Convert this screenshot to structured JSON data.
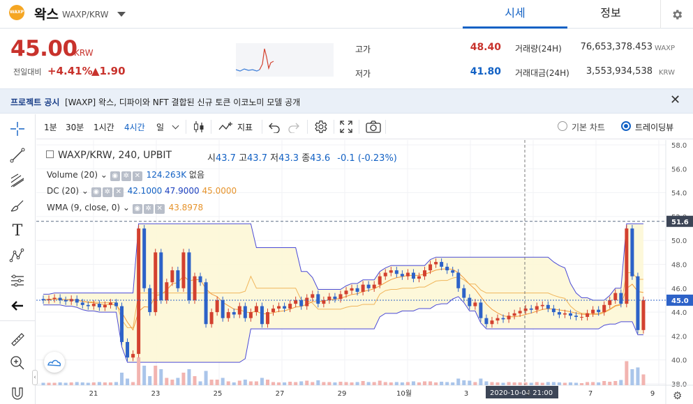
{
  "header": {
    "logo_text": "WAXP",
    "coin_name": "왁스",
    "pair": "WAXP/KRW",
    "tabs": [
      "시세",
      "정보"
    ]
  },
  "price": {
    "current": "45.00",
    "unit": "KRW",
    "change_label": "전일대비",
    "change_pct": "+4.41%",
    "change_abs": "▲1.90"
  },
  "stats": {
    "high_label": "고가",
    "high_value": "48.40",
    "low_label": "저가",
    "low_value": "41.80",
    "volume_label": "거래량(24H)",
    "volume_value": "76,653,378.453",
    "volume_unit": "WAXP",
    "amount_label": "거래대금(24H)",
    "amount_value": "3,553,934,538",
    "amount_unit": "KRW"
  },
  "notice": {
    "title": "프로젝트 공시",
    "text": "[WAXP] 왁스, 디파이와 NFT 결합된 신규 토큰 이코노미 모델 공개"
  },
  "toolbar": {
    "intervals": [
      "1분",
      "30분",
      "1시간",
      "4시간",
      "일"
    ],
    "active_interval": "4시간",
    "indicators_label": "지표",
    "basic_chart_label": "기본 차트",
    "tradingview_label": "트레이딩뷰"
  },
  "chart_legend": {
    "symbol": "WAXP/KRW, 240, UPBIT",
    "o_label": "시",
    "o": "43.7",
    "h_label": "고",
    "h": "43.7",
    "l_label": "저",
    "l": "43.3",
    "c_label": "종",
    "c": "43.6",
    "change": "-0.1 (-0.23%)",
    "volume_name": "Volume (20)",
    "volume_value": "124.263K",
    "volume_extra": "없음",
    "dc_name": "DC (20)",
    "dc_low": "42.1000",
    "dc_high": "47.9000",
    "dc_mid": "45.0000",
    "wma_name": "WMA (9, close, 0)",
    "wma_value": "43.8978"
  },
  "chart_data": {
    "type": "candlestick",
    "y_ticks": [
      "58.0",
      "56.0",
      "54.0",
      "52.0",
      "50.0",
      "48.0",
      "46.0",
      "44.0",
      "42.0",
      "40.0",
      "38.0"
    ],
    "ylim": [
      38,
      58
    ],
    "x_ticks": [
      "21",
      "23",
      "25",
      "27",
      "29",
      "10월",
      "3",
      "5",
      "7",
      "9"
    ],
    "crosshair_x_label": "2020-10-04  21:00",
    "price_label": "45.0",
    "high_line_label": "51.6",
    "closes": [
      45.0,
      45.1,
      45.2,
      45.0,
      44.9,
      45.1,
      44.8,
      44.6,
      44.5,
      44.7,
      44.4,
      44.6,
      44.8,
      44.5,
      41.5,
      40.2,
      40.5,
      51.0,
      46.0,
      44.0,
      49.0,
      45.0,
      46.5,
      47.5,
      46.0,
      49.0,
      45.0,
      47.0,
      46.5,
      43.0,
      44.0,
      45.0,
      43.5,
      44.0,
      43.8,
      44.5,
      43.5,
      44.0,
      44.5,
      43.0,
      44.0,
      44.3,
      44.5,
      44.3,
      44.7,
      45.0,
      44.5,
      45.2,
      45.5,
      44.7,
      45.0,
      45.3,
      45.1,
      45.5,
      45.8,
      46.0,
      45.7,
      46.3,
      46.0,
      46.3,
      47.0,
      47.3,
      47.5,
      47.2,
      47.0,
      47.3,
      46.8,
      47.0,
      47.5,
      48.0,
      48.2,
      47.8,
      47.5,
      47.3,
      46.0,
      45.2,
      44.5,
      44.8,
      43.5,
      43.0,
      43.3,
      43.5,
      43.4,
      43.7,
      43.9,
      44.1,
      44.3,
      44.2,
      44.5,
      44.6,
      44.3,
      44.0,
      43.8,
      43.9,
      43.7,
      43.6,
      43.6,
      43.9,
      44.2,
      44.0,
      44.6,
      45.0,
      45.6,
      44.7,
      51.0,
      47.0,
      42.5,
      45.0
    ],
    "opens": [
      45.1,
      45.0,
      45.1,
      45.2,
      45.0,
      44.9,
      45.1,
      44.8,
      44.6,
      44.5,
      44.7,
      44.4,
      44.6,
      44.8,
      44.5,
      41.5,
      40.2,
      40.5,
      51.0,
      46.0,
      44.0,
      49.0,
      45.0,
      46.5,
      47.5,
      46.0,
      49.0,
      45.0,
      47.0,
      46.5,
      43.0,
      44.0,
      45.0,
      43.5,
      44.0,
      43.8,
      44.5,
      43.5,
      44.0,
      44.5,
      43.0,
      44.0,
      44.3,
      44.5,
      44.3,
      44.7,
      45.0,
      44.5,
      45.2,
      45.5,
      44.7,
      45.0,
      45.3,
      45.1,
      45.5,
      45.8,
      46.0,
      45.7,
      46.3,
      46.0,
      46.3,
      47.0,
      47.3,
      47.5,
      47.2,
      47.0,
      47.3,
      46.8,
      47.0,
      47.5,
      48.0,
      48.2,
      47.8,
      47.5,
      47.3,
      46.0,
      45.2,
      44.5,
      44.8,
      43.5,
      43.0,
      43.3,
      43.5,
      43.4,
      43.7,
      43.9,
      44.1,
      44.3,
      44.2,
      44.5,
      44.6,
      44.3,
      44.0,
      43.8,
      43.9,
      43.7,
      43.6,
      43.6,
      43.9,
      44.2,
      44.0,
      44.6,
      45.0,
      45.6,
      44.7,
      51.0,
      47.0,
      42.5
    ]
  },
  "icons": {
    "gear": "gear-icon",
    "close": "close-icon",
    "crosshair": "crosshair-icon",
    "trend_line": "trend-line-icon",
    "fib": "fib-icon",
    "brush": "brush-icon",
    "text": "T",
    "pattern": "pattern-icon",
    "measure": "measure-icon",
    "back": "back-arrow-icon",
    "ruler": "ruler-icon",
    "zoom": "zoom-in-icon"
  }
}
